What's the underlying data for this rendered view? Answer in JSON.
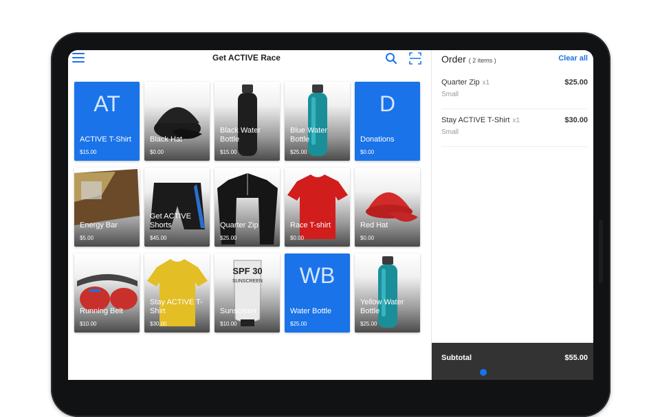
{
  "app": {
    "title": "Get ACTIVE Race"
  },
  "icons": {
    "menu": "hamburger-menu-icon",
    "search": "search-icon",
    "scan": "barcode-scan-icon"
  },
  "colors": {
    "accent": "#1a73e8",
    "subtotal_bg": "#333333"
  },
  "products": [
    {
      "name": "ACTIVE T-Shirt",
      "price": "$15.00",
      "abbr": "AT",
      "style": "blue"
    },
    {
      "name": "Black Hat",
      "price": "$0.00",
      "image": "black-cap",
      "style": "photo"
    },
    {
      "name": "Black Water Bottle",
      "price": "$15.00",
      "image": "black-bottle",
      "style": "photo"
    },
    {
      "name": "Blue Water Bottle",
      "price": "$25.00",
      "image": "teal-bottle",
      "style": "photo"
    },
    {
      "name": "Donations",
      "price": "$0.00",
      "abbr": "D",
      "style": "blue"
    },
    {
      "name": "Energy Bar",
      "price": "$5.00",
      "image": "energy-bar",
      "style": "photo"
    },
    {
      "name": "Get ACTIVE Shorts",
      "price": "$45.00",
      "image": "shorts",
      "style": "photo"
    },
    {
      "name": "Quarter Zip",
      "price": "$25.00",
      "image": "quarter-zip",
      "style": "photo"
    },
    {
      "name": "Race T-shirt",
      "price": "$0.00",
      "image": "red-tshirt",
      "style": "photo"
    },
    {
      "name": "Red Hat",
      "price": "$0.00",
      "image": "red-cap",
      "style": "photo"
    },
    {
      "name": "Running Belt",
      "price": "$10.00",
      "image": "running-belt",
      "style": "photo"
    },
    {
      "name": "Stay ACTIVE T-Shirt",
      "price": "$30.00",
      "image": "yellow-tshirt",
      "style": "photo"
    },
    {
      "name": "Sunscreen",
      "price": "$10.00",
      "image": "sunscreen",
      "style": "photo",
      "image_text": [
        "SPF 30",
        "SUNSCREEN"
      ]
    },
    {
      "name": "Water Bottle",
      "price": "$25.00",
      "abbr": "WB",
      "style": "blue"
    },
    {
      "name": "Yellow Water Bottle",
      "price": "$25.00",
      "image": "teal-bottle",
      "style": "photo"
    }
  ],
  "order": {
    "title": "Order",
    "count_label": "( 2 items )",
    "clear_label": "Clear all",
    "items": [
      {
        "name": "Quarter Zip",
        "qty": "x1",
        "size": "Small",
        "price": "$25.00"
      },
      {
        "name": "Stay ACTIVE T-Shirt",
        "qty": "x1",
        "size": "Small",
        "price": "$30.00"
      }
    ],
    "subtotal_label": "Subtotal",
    "subtotal_value": "$55.00"
  }
}
